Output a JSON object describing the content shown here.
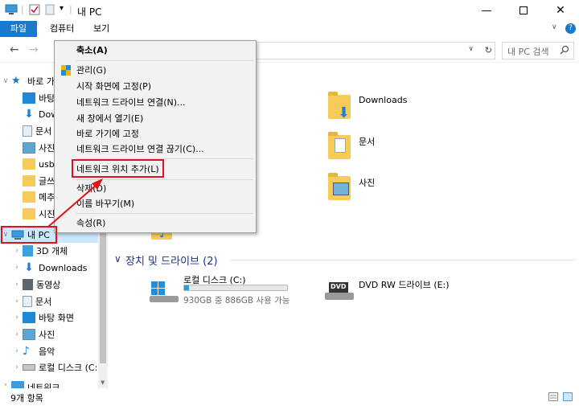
{
  "window": {
    "title": "내 PC",
    "dropdown_arrow": "▾"
  },
  "ribbon": {
    "tabs": [
      {
        "label": "파일"
      },
      {
        "label": "컴퓨터"
      },
      {
        "label": "보기"
      }
    ],
    "help": "?"
  },
  "address": {
    "refresh": "↻",
    "search_placeholder": "내 PC 검색"
  },
  "context_menu": {
    "items": [
      {
        "label": "축소(A)"
      },
      {
        "label": "관리(G)"
      },
      {
        "label": "시작 화면에 고정(P)"
      },
      {
        "label": "네트워크 드라이브 연결(N)..."
      },
      {
        "label": "새 창에서 열기(E)"
      },
      {
        "label": "바로 가기에 고정"
      },
      {
        "label": "네트워크 드라이브 연결 끊기(C)..."
      },
      {
        "label": "네트워크 위치 추가(L)"
      },
      {
        "label": "삭제(D)"
      },
      {
        "label": "이름 바꾸기(M)"
      },
      {
        "label": "속성(R)"
      }
    ]
  },
  "nav": {
    "quick_access": "바로 가기",
    "items": [
      {
        "label": "바탕"
      },
      {
        "label": "Dow"
      },
      {
        "label": "문서"
      },
      {
        "label": "사진"
      },
      {
        "label": "usb"
      },
      {
        "label": "글쓰"
      },
      {
        "label": "메추"
      },
      {
        "label": "시진"
      }
    ],
    "this_pc": "내 PC",
    "pc_items": [
      {
        "label": "3D 개체"
      },
      {
        "label": "Downloads"
      },
      {
        "label": "동영상"
      },
      {
        "label": "문서"
      },
      {
        "label": "바탕 화면"
      },
      {
        "label": "사진"
      },
      {
        "label": "음악"
      },
      {
        "label": "로컬 디스크 (C:)"
      }
    ],
    "network": "네트워크"
  },
  "main": {
    "folders": [
      {
        "label": "Downloads"
      },
      {
        "label": "문서"
      },
      {
        "label": "사진"
      }
    ],
    "drives_header": "장치 및 드라이브 (2)",
    "drives": [
      {
        "label": "로컬 디스크 (C:)",
        "detail": "930GB 중 886GB 사용 가능",
        "used_fraction": 0.05
      },
      {
        "label": "DVD RW 드라이브 (E:)"
      }
    ],
    "dvd_text": "DVD"
  },
  "status": {
    "item_count": "9개 항목"
  },
  "colors": {
    "accent": "#1979ca",
    "highlight_red": "#e4101a",
    "folder_yellow": "#f6cb58",
    "selection": "#cce8ff"
  }
}
